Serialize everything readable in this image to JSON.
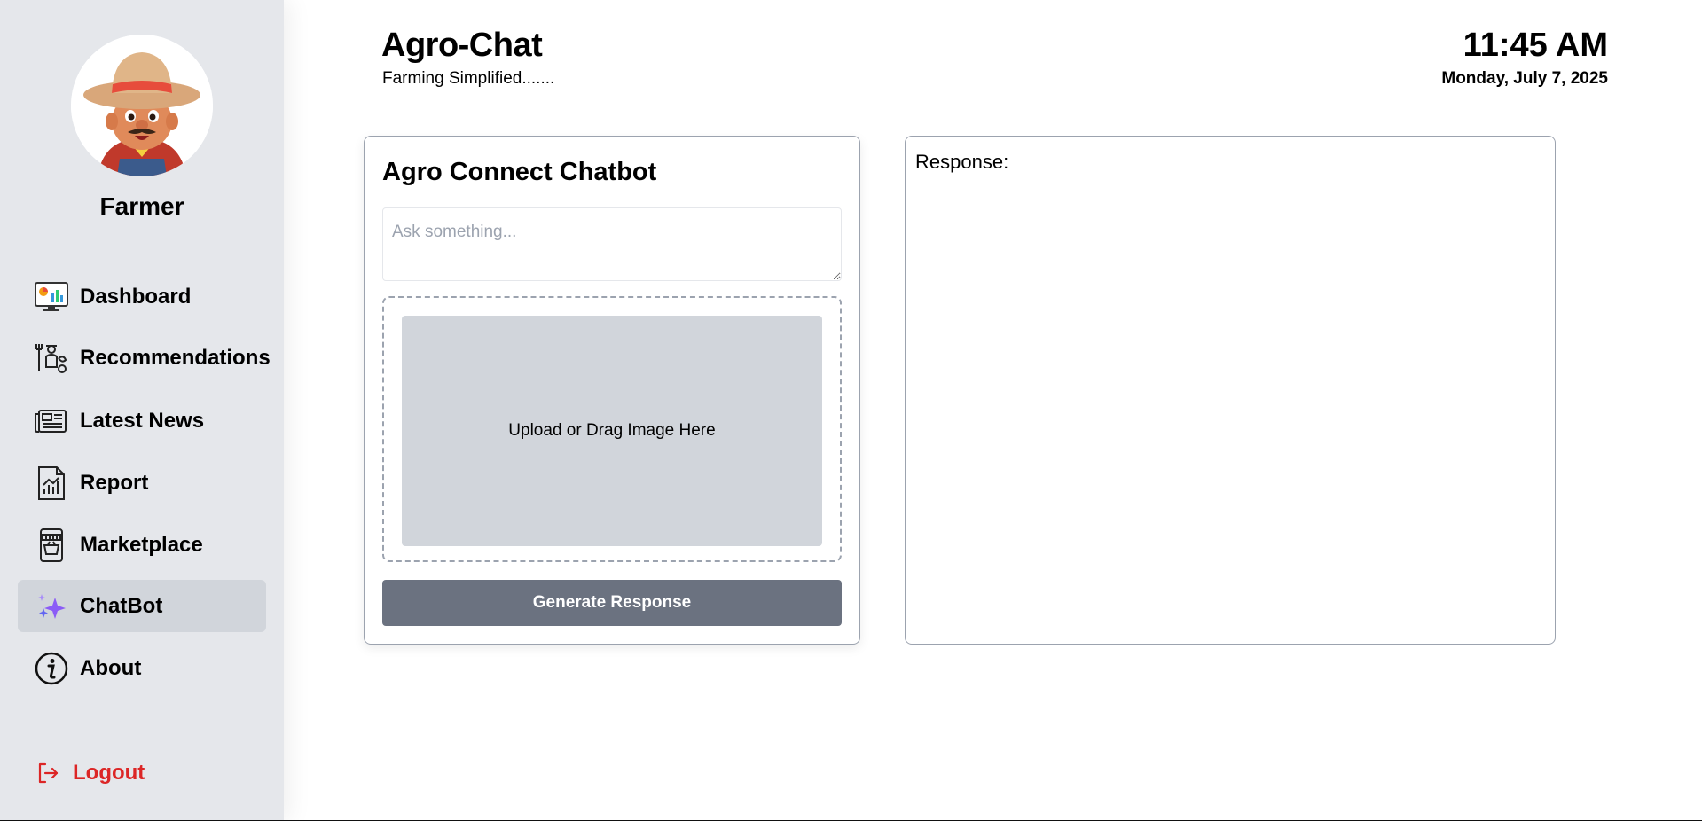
{
  "user": {
    "name": "Farmer"
  },
  "nav": {
    "items": [
      {
        "label": "Dashboard",
        "icon": "dashboard-monitor-icon"
      },
      {
        "label": "Recommendations",
        "icon": "farmer-recommendations-icon"
      },
      {
        "label": "Latest News",
        "icon": "newspaper-icon"
      },
      {
        "label": "Report",
        "icon": "report-chart-icon"
      },
      {
        "label": "Marketplace",
        "icon": "marketplace-store-icon"
      },
      {
        "label": "ChatBot",
        "icon": "sparkles-icon"
      },
      {
        "label": "About",
        "icon": "info-icon"
      }
    ],
    "active": "ChatBot",
    "logout": {
      "label": "Logout",
      "icon": "logout-icon"
    }
  },
  "header": {
    "title": "Agro-Chat",
    "subtitle": "Farming Simplified......."
  },
  "clock": {
    "time": "11:45 AM",
    "date": "Monday, July 7, 2025"
  },
  "chatbot": {
    "heading": "Agro Connect Chatbot",
    "input_placeholder": "Ask something...",
    "upload_text": "Upload or Drag Image Here",
    "generate_label": "Generate Response"
  },
  "response": {
    "label": "Response:"
  },
  "colors": {
    "sidebar_bg": "#e5e7eb",
    "active_item_bg": "#d1d5db",
    "button_bg": "#6b7280",
    "logout": "#dc2626",
    "accent_sparkle": "#8b5cf6"
  }
}
